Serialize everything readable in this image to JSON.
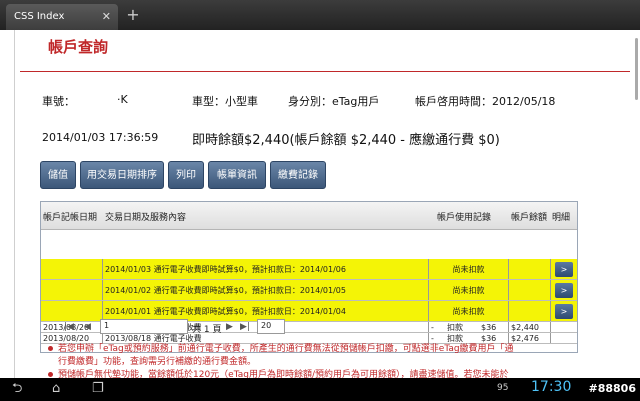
{
  "browser": {
    "tab_title": "CSS Index",
    "tab_close": "✕",
    "new_tab": "+"
  },
  "page": {
    "title": "帳戶查詢",
    "info": {
      "car_no_label": "車號：",
      "car_no_value": "·K",
      "car_type": "車型：小型車",
      "identity": "身分別：eTag用戶",
      "open_time": "帳戶啓用時間：2012/05/18",
      "timestamp": "2014/01/03 17:36:59",
      "balance_summary": "即時餘額$2,440(帳戶餘額 $2,440 - 應繳通行費 $0)"
    },
    "buttons": [
      "儲值",
      "用交易日期排序",
      "列印",
      "帳單資訊",
      "繳費記錄"
    ],
    "table": {
      "headers": [
        "帳戶記帳日期",
        "交易日期及服務內容",
        "帳戶使用記錄",
        "帳戶餘額",
        "明細"
      ],
      "rows": [
        {
          "date": "",
          "desc": "2014/01/03 通行電子收費即時試算$0，預計扣款日：2014/01/06",
          "usage": "尚未扣款",
          "balance": "",
          "detail": ">"
        },
        {
          "date": "",
          "desc": "2014/01/02 通行電子收費即時試算$0，預計扣款日：2014/01/05",
          "usage": "尚未扣款",
          "balance": "",
          "detail": ">"
        },
        {
          "date": "",
          "desc": "2014/01/01 通行電子收費即時試算$0，預計扣款日：2014/01/04",
          "usage": "尚未扣款",
          "balance": "",
          "detail": ">"
        },
        {
          "date": "2013/08/20",
          "desc": "2013/08/18 通行電子收費",
          "usage_sign": "-",
          "usage": "扣款",
          "amount": "$36",
          "balance": "$2,440"
        },
        {
          "date": "2013/08/20",
          "desc": "2013/08/18 通行電子收費",
          "usage_sign": "-",
          "usage": "扣款",
          "amount": "$36",
          "balance": "$2,476"
        }
      ]
    },
    "pager": {
      "first": "|◀",
      "prev": "◀",
      "page_value": "1",
      "of_pages": "共 1 頁",
      "next": "▶",
      "last": "▶|",
      "page_size": "20"
    },
    "notes": [
      "若您申辦「eTag或預約服務」前通行電子收費，所產生的通行費無法從預儲帳戶扣繳，可點選非eTag繳費用戶「通",
      "行費繳費」功能，查詢需另行補繳的通行費金額。",
      "預儲帳戶無代墊功能，當餘額低於120元（eTag用戶為即時餘額/預約用戶為可用餘額），請盡速儲值。若您未能於"
    ]
  },
  "system_bar": {
    "back": "⮌",
    "home": "⌂",
    "recents": "❐",
    "battery": "95",
    "time": "17:30",
    "watermark": "#88806"
  }
}
